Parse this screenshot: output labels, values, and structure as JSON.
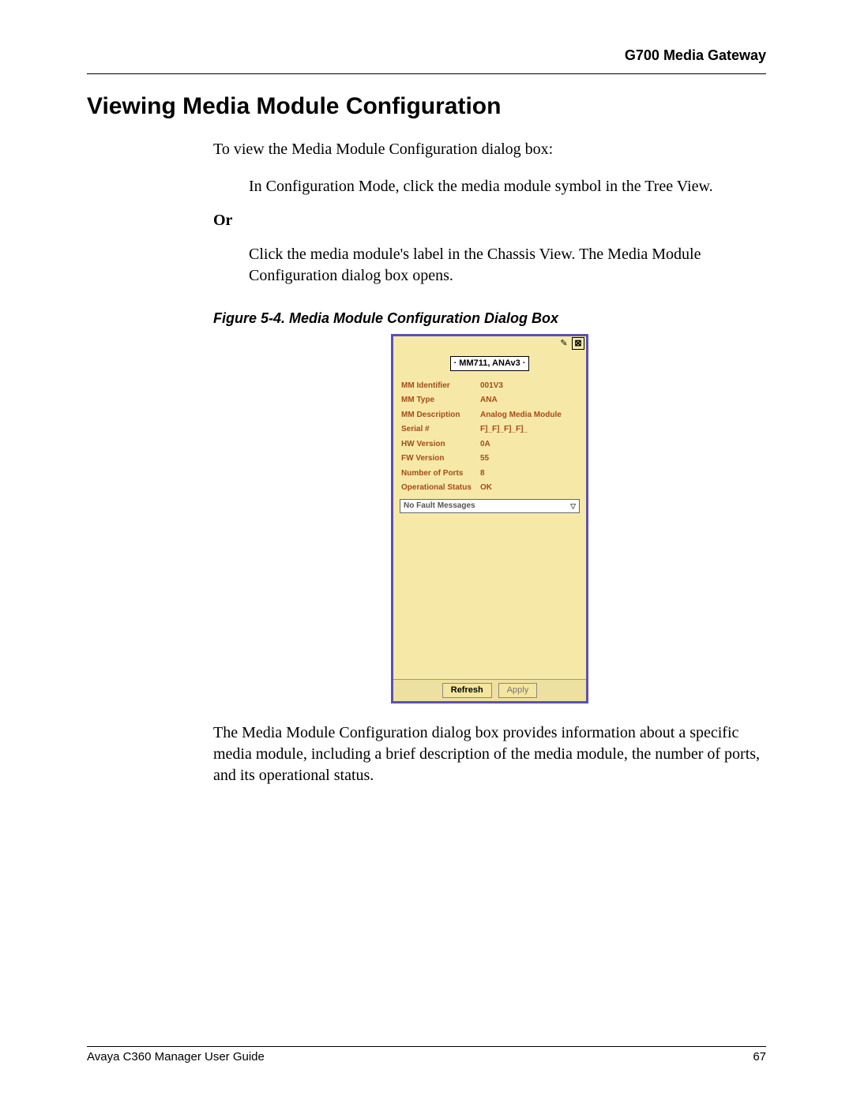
{
  "header": {
    "chapter": "G700 Media Gateway"
  },
  "title": "Viewing Media Module Configuration",
  "intro": "To view the Media Module Configuration dialog box:",
  "step1": "In Configuration Mode, click the media module symbol in the Tree View.",
  "or": "Or",
  "step2": "Click the media module's label in the Chassis View. The Media Module Configuration dialog box opens.",
  "figure_caption": "Figure 5-4.  Media Module Configuration Dialog Box",
  "dialog": {
    "title": "· MM711, ANAv3 ·",
    "close_glyph": "⊠",
    "help_glyph": "✎",
    "rows": [
      {
        "label": "MM Identifier",
        "value": "001V3"
      },
      {
        "label": "MM Type",
        "value": "ANA"
      },
      {
        "label": "MM Description",
        "value": "Analog Media Module"
      },
      {
        "label": "Serial #",
        "value": "F]_F]_F]_F]_"
      },
      {
        "label": "HW Version",
        "value": "0A"
      },
      {
        "label": "FW Version",
        "value": "55"
      },
      {
        "label": "Number of Ports",
        "value": "8"
      },
      {
        "label": "Operational Status",
        "value": "OK"
      }
    ],
    "fault_text": "No Fault Messages",
    "fault_chevron": "▽",
    "refresh": "Refresh",
    "apply": "Apply"
  },
  "after_figure": "The Media Module Configuration dialog box provides information about a specific media module, including a brief description of the media module, the number of ports, and its operational status.",
  "footer": {
    "guide": "Avaya C360 Manager User Guide",
    "page": "67"
  }
}
